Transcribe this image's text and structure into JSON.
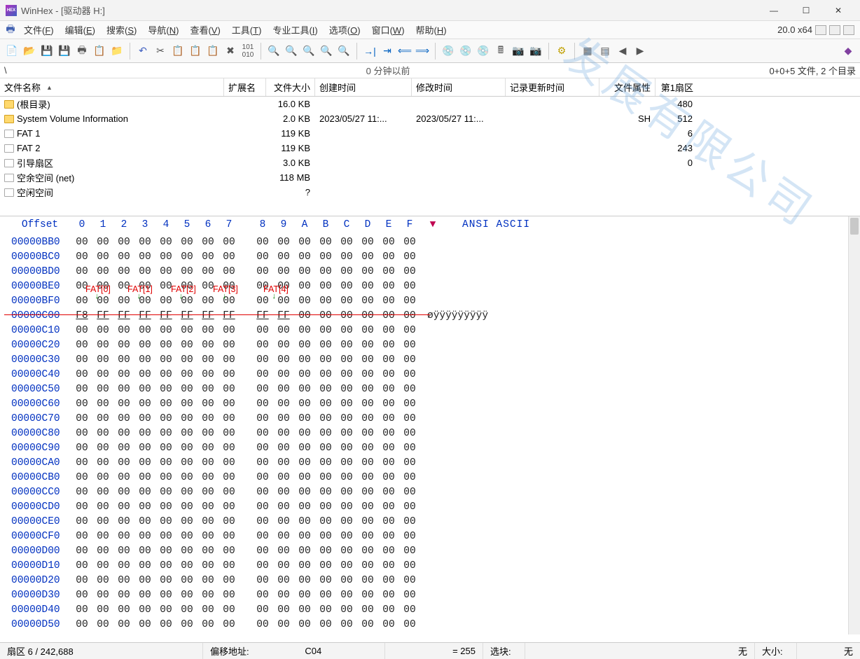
{
  "title": "WinHex - [驱动器 H:]",
  "version_label": "20.0 x64",
  "menus": [
    "文件(F)",
    "编辑(E)",
    "搜索(S)",
    "导航(N)",
    "查看(V)",
    "工具(T)",
    "专业工具(I)",
    "选项(O)",
    "窗口(W)",
    "帮助(H)"
  ],
  "pathbar": {
    "left": "\\",
    "center": "0 分钟以前",
    "right": "0+0+5 文件, 2 个目录"
  },
  "columns": {
    "name": "文件名称",
    "ext": "扩展名",
    "size": "文件大小",
    "created": "创建时间",
    "modified": "修改时间",
    "updated": "记录更新时间",
    "attr": "文件属性",
    "sector": "第1扇区"
  },
  "files": [
    {
      "icon": "folder",
      "name": "(根目录)",
      "ext": "",
      "size": "16.0 KB",
      "created": "",
      "modified": "",
      "updated": "",
      "attr": "",
      "sector": "480"
    },
    {
      "icon": "folder",
      "name": "System Volume Information",
      "ext": "",
      "size": "2.0 KB",
      "created": "2023/05/27  11:...",
      "modified": "2023/05/27  11:...",
      "updated": "",
      "attr": "SH",
      "sector": "512"
    },
    {
      "icon": "doc",
      "name": "FAT 1",
      "ext": "",
      "size": "119 KB",
      "created": "",
      "modified": "",
      "updated": "",
      "attr": "",
      "sector": "6"
    },
    {
      "icon": "doc",
      "name": "FAT 2",
      "ext": "",
      "size": "119 KB",
      "created": "",
      "modified": "",
      "updated": "",
      "attr": "",
      "sector": "243"
    },
    {
      "icon": "doc",
      "name": "引导扇区",
      "ext": "",
      "size": "3.0 KB",
      "created": "",
      "modified": "",
      "updated": "",
      "attr": "",
      "sector": "0"
    },
    {
      "icon": "doc",
      "name": "空余空间 (net)",
      "ext": "",
      "size": "118 MB",
      "created": "",
      "modified": "",
      "updated": "",
      "attr": "",
      "sector": ""
    },
    {
      "icon": "doc",
      "name": "空闲空间",
      "ext": "",
      "size": "?",
      "created": "",
      "modified": "",
      "updated": "",
      "attr": "",
      "sector": ""
    }
  ],
  "hex": {
    "offset_label": "Offset",
    "ascii_label": "ANSI ASCII",
    "cols": [
      "0",
      "1",
      "2",
      "3",
      "4",
      "5",
      "6",
      "7",
      "8",
      "9",
      "A",
      "B",
      "C",
      "D",
      "E",
      "F"
    ],
    "v_label": "▼",
    "rows": [
      {
        "off": "00000BB0",
        "b": [
          "00",
          "00",
          "00",
          "00",
          "00",
          "00",
          "00",
          "00",
          "00",
          "00",
          "00",
          "00",
          "00",
          "00",
          "00",
          "00"
        ],
        "a": ""
      },
      {
        "off": "00000BC0",
        "b": [
          "00",
          "00",
          "00",
          "00",
          "00",
          "00",
          "00",
          "00",
          "00",
          "00",
          "00",
          "00",
          "00",
          "00",
          "00",
          "00"
        ],
        "a": ""
      },
      {
        "off": "00000BD0",
        "b": [
          "00",
          "00",
          "00",
          "00",
          "00",
          "00",
          "00",
          "00",
          "00",
          "00",
          "00",
          "00",
          "00",
          "00",
          "00",
          "00"
        ],
        "a": ""
      },
      {
        "off": "00000BE0",
        "b": [
          "00",
          "00",
          "00",
          "00",
          "00",
          "00",
          "00",
          "00",
          "00",
          "00",
          "00",
          "00",
          "00",
          "00",
          "00",
          "00"
        ],
        "a": ""
      },
      {
        "off": "00000BF0",
        "b": [
          "00",
          "00",
          "00",
          "00",
          "00",
          "00",
          "00",
          "00",
          "00",
          "00",
          "00",
          "00",
          "00",
          "00",
          "00",
          "00"
        ],
        "a": ""
      },
      {
        "off": "00000C00",
        "b": [
          "F8",
          "FF",
          "FF",
          "FF",
          "FF",
          "FF",
          "FF",
          "FF",
          "FF",
          "FF",
          "00",
          "00",
          "00",
          "00",
          "00",
          "00"
        ],
        "a": "øÿÿÿÿÿÿÿÿÿ",
        "sel": true
      },
      {
        "off": "00000C10",
        "b": [
          "00",
          "00",
          "00",
          "00",
          "00",
          "00",
          "00",
          "00",
          "00",
          "00",
          "00",
          "00",
          "00",
          "00",
          "00",
          "00"
        ],
        "a": ""
      },
      {
        "off": "00000C20",
        "b": [
          "00",
          "00",
          "00",
          "00",
          "00",
          "00",
          "00",
          "00",
          "00",
          "00",
          "00",
          "00",
          "00",
          "00",
          "00",
          "00"
        ],
        "a": ""
      },
      {
        "off": "00000C30",
        "b": [
          "00",
          "00",
          "00",
          "00",
          "00",
          "00",
          "00",
          "00",
          "00",
          "00",
          "00",
          "00",
          "00",
          "00",
          "00",
          "00"
        ],
        "a": ""
      },
      {
        "off": "00000C40",
        "b": [
          "00",
          "00",
          "00",
          "00",
          "00",
          "00",
          "00",
          "00",
          "00",
          "00",
          "00",
          "00",
          "00",
          "00",
          "00",
          "00"
        ],
        "a": ""
      },
      {
        "off": "00000C50",
        "b": [
          "00",
          "00",
          "00",
          "00",
          "00",
          "00",
          "00",
          "00",
          "00",
          "00",
          "00",
          "00",
          "00",
          "00",
          "00",
          "00"
        ],
        "a": ""
      },
      {
        "off": "00000C60",
        "b": [
          "00",
          "00",
          "00",
          "00",
          "00",
          "00",
          "00",
          "00",
          "00",
          "00",
          "00",
          "00",
          "00",
          "00",
          "00",
          "00"
        ],
        "a": ""
      },
      {
        "off": "00000C70",
        "b": [
          "00",
          "00",
          "00",
          "00",
          "00",
          "00",
          "00",
          "00",
          "00",
          "00",
          "00",
          "00",
          "00",
          "00",
          "00",
          "00"
        ],
        "a": ""
      },
      {
        "off": "00000C80",
        "b": [
          "00",
          "00",
          "00",
          "00",
          "00",
          "00",
          "00",
          "00",
          "00",
          "00",
          "00",
          "00",
          "00",
          "00",
          "00",
          "00"
        ],
        "a": ""
      },
      {
        "off": "00000C90",
        "b": [
          "00",
          "00",
          "00",
          "00",
          "00",
          "00",
          "00",
          "00",
          "00",
          "00",
          "00",
          "00",
          "00",
          "00",
          "00",
          "00"
        ],
        "a": ""
      },
      {
        "off": "00000CA0",
        "b": [
          "00",
          "00",
          "00",
          "00",
          "00",
          "00",
          "00",
          "00",
          "00",
          "00",
          "00",
          "00",
          "00",
          "00",
          "00",
          "00"
        ],
        "a": ""
      },
      {
        "off": "00000CB0",
        "b": [
          "00",
          "00",
          "00",
          "00",
          "00",
          "00",
          "00",
          "00",
          "00",
          "00",
          "00",
          "00",
          "00",
          "00",
          "00",
          "00"
        ],
        "a": ""
      },
      {
        "off": "00000CC0",
        "b": [
          "00",
          "00",
          "00",
          "00",
          "00",
          "00",
          "00",
          "00",
          "00",
          "00",
          "00",
          "00",
          "00",
          "00",
          "00",
          "00"
        ],
        "a": ""
      },
      {
        "off": "00000CD0",
        "b": [
          "00",
          "00",
          "00",
          "00",
          "00",
          "00",
          "00",
          "00",
          "00",
          "00",
          "00",
          "00",
          "00",
          "00",
          "00",
          "00"
        ],
        "a": ""
      },
      {
        "off": "00000CE0",
        "b": [
          "00",
          "00",
          "00",
          "00",
          "00",
          "00",
          "00",
          "00",
          "00",
          "00",
          "00",
          "00",
          "00",
          "00",
          "00",
          "00"
        ],
        "a": ""
      },
      {
        "off": "00000CF0",
        "b": [
          "00",
          "00",
          "00",
          "00",
          "00",
          "00",
          "00",
          "00",
          "00",
          "00",
          "00",
          "00",
          "00",
          "00",
          "00",
          "00"
        ],
        "a": ""
      },
      {
        "off": "00000D00",
        "b": [
          "00",
          "00",
          "00",
          "00",
          "00",
          "00",
          "00",
          "00",
          "00",
          "00",
          "00",
          "00",
          "00",
          "00",
          "00",
          "00"
        ],
        "a": ""
      },
      {
        "off": "00000D10",
        "b": [
          "00",
          "00",
          "00",
          "00",
          "00",
          "00",
          "00",
          "00",
          "00",
          "00",
          "00",
          "00",
          "00",
          "00",
          "00",
          "00"
        ],
        "a": ""
      },
      {
        "off": "00000D20",
        "b": [
          "00",
          "00",
          "00",
          "00",
          "00",
          "00",
          "00",
          "00",
          "00",
          "00",
          "00",
          "00",
          "00",
          "00",
          "00",
          "00"
        ],
        "a": ""
      },
      {
        "off": "00000D30",
        "b": [
          "00",
          "00",
          "00",
          "00",
          "00",
          "00",
          "00",
          "00",
          "00",
          "00",
          "00",
          "00",
          "00",
          "00",
          "00",
          "00"
        ],
        "a": ""
      },
      {
        "off": "00000D40",
        "b": [
          "00",
          "00",
          "00",
          "00",
          "00",
          "00",
          "00",
          "00",
          "00",
          "00",
          "00",
          "00",
          "00",
          "00",
          "00",
          "00"
        ],
        "a": ""
      },
      {
        "off": "00000D50",
        "b": [
          "00",
          "00",
          "00",
          "00",
          "00",
          "00",
          "00",
          "00",
          "00",
          "00",
          "00",
          "00",
          "00",
          "00",
          "00",
          "00"
        ],
        "a": ""
      }
    ],
    "annotations": [
      "FAT[0]",
      "FAT[1]",
      "FAT[2]",
      "FAT[3]",
      "FAT[4]"
    ]
  },
  "status": {
    "sector": "扇区 6 / 242,688",
    "offset_label": "偏移地址:",
    "offset_value": "C04",
    "value": "= 255",
    "selection": "选块:",
    "none": "无",
    "size": "大小:"
  },
  "watermark": "发展有限公司"
}
